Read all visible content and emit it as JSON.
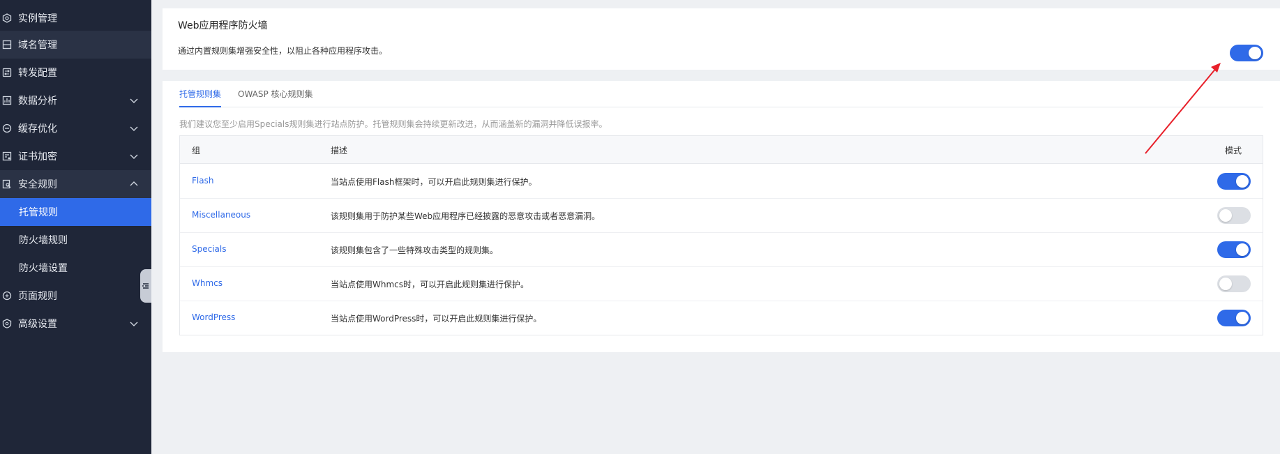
{
  "sidebar": {
    "items": [
      {
        "label": "实例管理",
        "icon": "instance-icon",
        "expandable": false
      },
      {
        "label": "域名管理",
        "icon": "domain-icon",
        "expandable": false
      },
      {
        "label": "转发配置",
        "icon": "forward-icon",
        "expandable": false
      },
      {
        "label": "数据分析",
        "icon": "chart-icon",
        "expandable": true
      },
      {
        "label": "缓存优化",
        "icon": "cache-icon",
        "expandable": true
      },
      {
        "label": "证书加密",
        "icon": "certificate-icon",
        "expandable": true
      },
      {
        "label": "安全规则",
        "icon": "security-icon",
        "expandable": true,
        "expanded": true
      },
      {
        "label": "页面规则",
        "icon": "page-rule-icon",
        "expandable": false
      },
      {
        "label": "高级设置",
        "icon": "advanced-icon",
        "expandable": true
      }
    ],
    "sub_items": [
      {
        "label": "托管规则",
        "active": true
      },
      {
        "label": "防火墙规则",
        "active": false
      },
      {
        "label": "防火墙设置",
        "active": false
      }
    ]
  },
  "waf": {
    "title": "Web应用程序防火墙",
    "description": "通过内置规则集增强安全性，以阻止各种应用程序攻击。",
    "enabled": true
  },
  "tabs": [
    {
      "label": "托管规则集",
      "active": true
    },
    {
      "label": "OWASP 核心规则集",
      "active": false
    }
  ],
  "hint": "我们建议您至少启用Specials规则集进行站点防护。托管规则集会持续更新改进，从而涵盖新的漏洞并降低误报率。",
  "table": {
    "headers": {
      "group": "组",
      "description": "描述",
      "mode": "模式"
    },
    "rows": [
      {
        "group": "Flash",
        "description": "当站点使用Flash框架时，可以开启此规则集进行保护。",
        "enabled": true
      },
      {
        "group": "Miscellaneous",
        "description": "该规则集用于防护某些Web应用程序已经披露的恶意攻击或者恶意漏洞。",
        "enabled": false
      },
      {
        "group": "Specials",
        "description": "该规则集包含了一些特殊攻击类型的规则集。",
        "enabled": true
      },
      {
        "group": "Whmcs",
        "description": "当站点使用Whmcs时，可以开启此规则集进行保护。",
        "enabled": false
      },
      {
        "group": "WordPress",
        "description": "当站点使用WordPress时，可以开启此规则集进行保护。",
        "enabled": true
      }
    ]
  },
  "colors": {
    "accent": "#2f6ae8",
    "sidebar_bg": "#1f2638",
    "annotation_arrow": "#e8202a"
  }
}
